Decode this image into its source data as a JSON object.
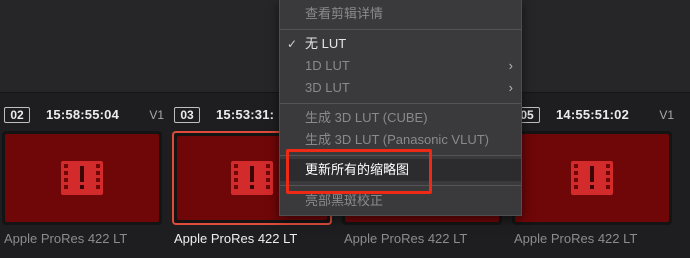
{
  "context_menu": {
    "items": [
      {
        "label": "查看剪辑详情",
        "enabled": false,
        "checked": false,
        "submenu": false
      },
      {
        "label": "无 LUT",
        "enabled": true,
        "checked": true,
        "submenu": false
      },
      {
        "label": "1D LUT",
        "enabled": false,
        "checked": false,
        "submenu": true
      },
      {
        "label": "3D LUT",
        "enabled": false,
        "checked": false,
        "submenu": true
      },
      {
        "label": "生成 3D LUT (CUBE)",
        "enabled": false,
        "checked": false,
        "submenu": false
      },
      {
        "label": "生成 3D LUT (Panasonic VLUT)",
        "enabled": false,
        "checked": false,
        "submenu": false
      },
      {
        "label": "更新所有的缩略图",
        "enabled": true,
        "checked": false,
        "submenu": false,
        "highlighted": true
      },
      {
        "label": "亮部黑斑校正",
        "enabled": false,
        "checked": false,
        "submenu": false
      }
    ],
    "check_glyph": "✓",
    "submenu_glyph": "›"
  },
  "clips": [
    {
      "number": "02",
      "timecode": "15:58:55:04",
      "track": "V1",
      "name": "Apple ProRes 422 LT",
      "selected": false
    },
    {
      "number": "03",
      "timecode": "15:53:31:",
      "track": "",
      "name": "Apple ProRes 422 LT",
      "selected": true
    },
    {
      "number": "",
      "timecode": "",
      "track": "",
      "name": "Apple ProRes 422 LT",
      "selected": false
    },
    {
      "number": "05",
      "timecode": "14:55:51:02",
      "track": "V1",
      "name": "Apple ProRes 422 LT",
      "selected": false
    }
  ],
  "thumbnail_icon": "media-offline-icon",
  "colors": {
    "thumbnail_bg": "#6f0608",
    "selected_border": "#e04c3c",
    "annotation_box": "#ef2a14"
  }
}
